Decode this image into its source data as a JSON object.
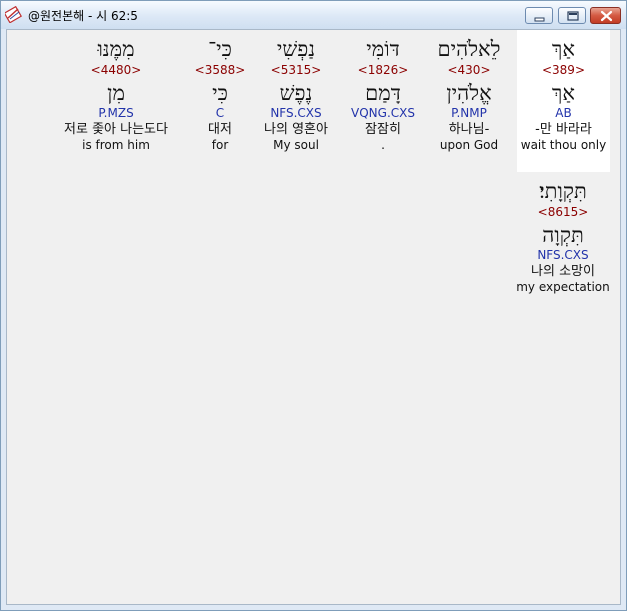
{
  "window": {
    "title": "@원전본해 - 시 62:5",
    "icon": "bible-app-icon"
  },
  "words": [
    {
      "hebrew": "אַךְ",
      "strong": "<389>",
      "lemma": "אַךְ",
      "morph": "AB",
      "korean": "-만 바라라",
      "english": "wait thou only",
      "selected": true
    },
    {
      "hebrew": "לֵאלֹהִים",
      "strong": "<430>",
      "lemma": "אֱלֹהִין",
      "morph": "P.NMP",
      "korean": "하나님-",
      "english": "upon God",
      "selected": false
    },
    {
      "hebrew": "דּוֹמִּי",
      "strong": "<1826>",
      "lemma": "דָּמַם",
      "morph": "VQNG.CXS",
      "korean": "잠잠히",
      "english": ".",
      "selected": false
    },
    {
      "hebrew": "נַפְשִׁי",
      "strong": "<5315>",
      "lemma": "נֶפֶשׁ",
      "morph": "NFS.CXS",
      "korean": "나의 영혼아",
      "english": "My soul",
      "selected": false
    },
    {
      "hebrew": "כִּי־",
      "strong": "<3588>",
      "lemma": "כִּי",
      "morph": "C",
      "korean": "대저",
      "english": "for",
      "selected": false
    },
    {
      "hebrew": "מִמֶּנּוּ",
      "strong": "<4480>",
      "lemma": "מִן",
      "morph": "P.MZS",
      "korean": "저로 좇아 나는도다",
      "english": "is from him",
      "selected": false
    },
    {
      "hebrew": "תִּקְוָתִי׃",
      "strong": "<8615>",
      "lemma": "תִּקְוָה",
      "morph": "NFS.CXS",
      "korean": "나의 소망이",
      "english": "my expectation",
      "selected": false
    }
  ]
}
